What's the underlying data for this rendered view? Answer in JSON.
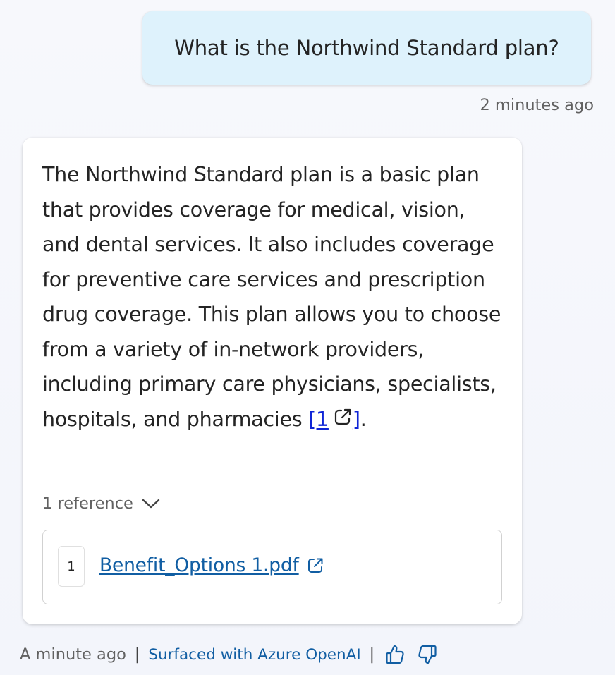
{
  "user_message": {
    "text": "What is the Northwind Standard plan?",
    "timestamp": "2 minutes ago"
  },
  "assistant_message": {
    "answer_text": "The Northwind Standard plan is a basic plan that provides coverage for medical, vision, and dental services. It also includes coverage for preventive care services and prescription drug coverage. This plan allows you to choose from a variety of in-network providers, including primary care physicians, specialists, hospitals, and pharmacies",
    "citation_open": "[1",
    "citation_close": "]",
    "answer_end": ".",
    "references_label": "1 reference",
    "references": [
      {
        "number": "1",
        "title": "Benefit_Options 1.pdf"
      }
    ],
    "timestamp": "A minute ago",
    "separator": "|",
    "surfaced_label": "Surfaced with Azure OpenAI"
  },
  "icons": {
    "citation": "external-link-icon",
    "reference": "external-link-icon",
    "toggle": "chevron-down-icon",
    "like": "thumbs-up-icon",
    "dislike": "thumbs-down-icon"
  },
  "colors": {
    "user_bubble": "#def2fc",
    "link": "#115ea3",
    "citation_link": "#0f25d6",
    "muted_text": "#616161"
  }
}
